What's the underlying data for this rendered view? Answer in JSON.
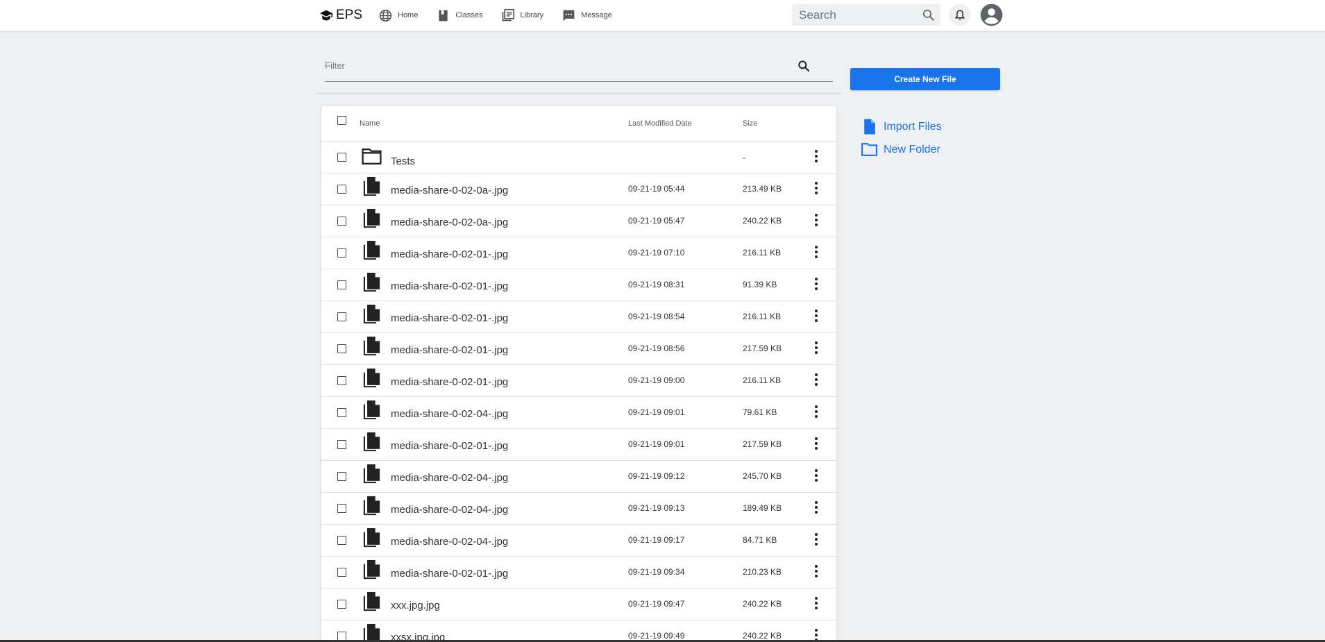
{
  "brand": {
    "name": "EPS"
  },
  "nav": [
    {
      "label": "Home",
      "icon": "globe-icon"
    },
    {
      "label": "Classes",
      "icon": "book-icon"
    },
    {
      "label": "Library",
      "icon": "library-icon"
    },
    {
      "label": "Message",
      "icon": "message-icon"
    }
  ],
  "search": {
    "placeholder": "Search"
  },
  "filter": {
    "placeholder": "Filter"
  },
  "actions": {
    "create_label": "Create New File",
    "import_label": "Import Files",
    "new_folder_label": "New Folder"
  },
  "table": {
    "columns": {
      "name": "Name",
      "date": "Last Modified Date",
      "size": "Size"
    },
    "rows": [
      {
        "type": "folder",
        "name": "Tests",
        "date": "",
        "size": "-"
      },
      {
        "type": "file",
        "name": "media-share-0-02-0a-.jpg",
        "date": "09-21-19 05:44",
        "size": "213.49 KB"
      },
      {
        "type": "file",
        "name": "media-share-0-02-0a-.jpg",
        "date": "09-21-19 05:47",
        "size": "240.22 KB"
      },
      {
        "type": "file",
        "name": "media-share-0-02-01-.jpg",
        "date": "09-21-19 07:10",
        "size": "216.11 KB"
      },
      {
        "type": "file",
        "name": "media-share-0-02-01-.jpg",
        "date": "09-21-19 08:31",
        "size": "91.39 KB"
      },
      {
        "type": "file",
        "name": "media-share-0-02-01-.jpg",
        "date": "09-21-19 08:54",
        "size": "216.11 KB"
      },
      {
        "type": "file",
        "name": "media-share-0-02-01-.jpg",
        "date": "09-21-19 08:56",
        "size": "217.59 KB"
      },
      {
        "type": "file",
        "name": "media-share-0-02-01-.jpg",
        "date": "09-21-19 09:00",
        "size": "216.11 KB"
      },
      {
        "type": "file",
        "name": "media-share-0-02-04-.jpg",
        "date": "09-21-19 09:01",
        "size": "79.61 KB"
      },
      {
        "type": "file",
        "name": "media-share-0-02-01-.jpg",
        "date": "09-21-19 09:01",
        "size": "217.59 KB"
      },
      {
        "type": "file",
        "name": "media-share-0-02-04-.jpg",
        "date": "09-21-19 09:12",
        "size": "245.70 KB"
      },
      {
        "type": "file",
        "name": "media-share-0-02-04-.jpg",
        "date": "09-21-19 09:13",
        "size": "189.49 KB"
      },
      {
        "type": "file",
        "name": "media-share-0-02-04-.jpg",
        "date": "09-21-19 09:17",
        "size": "84.71 KB"
      },
      {
        "type": "file",
        "name": "media-share-0-02-01-.jpg",
        "date": "09-21-19 09:34",
        "size": "210.23 KB"
      },
      {
        "type": "file",
        "name": "xxx.jpg.jpg",
        "date": "09-21-19 09:47",
        "size": "240.22 KB"
      },
      {
        "type": "file",
        "name": "xxsx.jpg.jpg",
        "date": "09-21-19 09:49",
        "size": "240.22 KB"
      }
    ]
  },
  "colors": {
    "accent": "#1a73e8",
    "background": "#eef0f2",
    "icon": "#222222"
  }
}
